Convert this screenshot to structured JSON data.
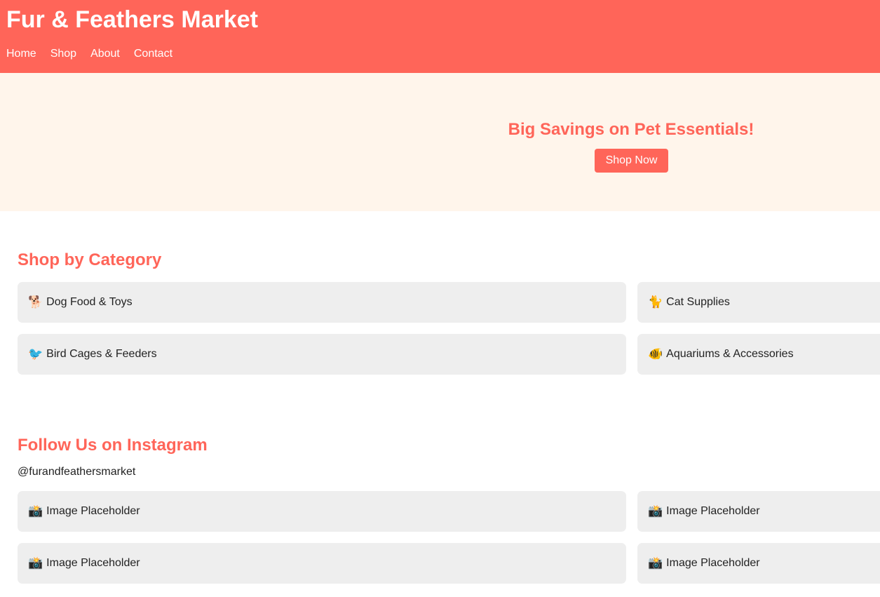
{
  "header": {
    "title": "Fur & Feathers Market",
    "nav": [
      "Home",
      "Shop",
      "About",
      "Contact"
    ]
  },
  "hero": {
    "title": "Big Savings on Pet Essentials!",
    "button": "Shop Now"
  },
  "categories": {
    "title": "Shop by Category",
    "items": [
      {
        "icon": "🐕",
        "label": "Dog Food & Toys"
      },
      {
        "icon": "🐈",
        "label": "Cat Supplies"
      },
      {
        "icon": "🐦",
        "label": "Bird Cages & Feeders"
      },
      {
        "icon": "🐠",
        "label": "Aquariums & Accessories"
      }
    ]
  },
  "instagram": {
    "title": "Follow Us on Instagram",
    "handle": "@furandfeathersmarket",
    "items": [
      {
        "icon": "📸",
        "label": "Image Placeholder"
      },
      {
        "icon": "📸",
        "label": "Image Placeholder"
      },
      {
        "icon": "📸",
        "label": "Image Placeholder"
      },
      {
        "icon": "📸",
        "label": "Image Placeholder"
      }
    ]
  },
  "colors": {
    "brand": "#ff6559",
    "hero_bg": "#fff5eb",
    "card_bg": "#eeeeee"
  }
}
